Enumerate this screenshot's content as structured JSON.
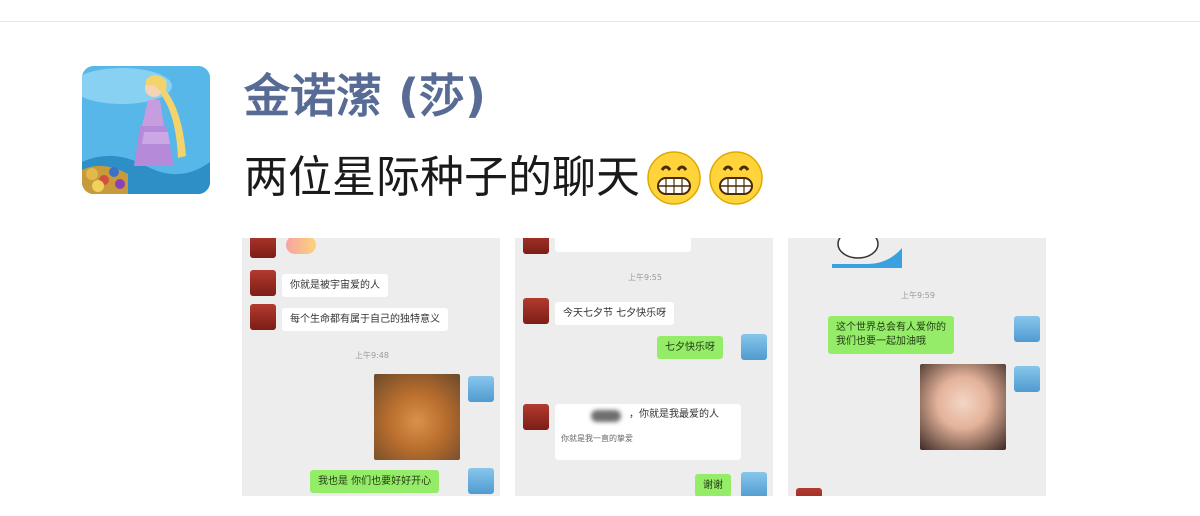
{
  "post": {
    "user_name": "金诺潆 (莎)",
    "text": "两位星际种子的聊天",
    "emojis": [
      "grinning-face-emoji",
      "grinning-face-emoji"
    ]
  },
  "thumbnails": [
    {
      "messages": [
        "你就是被宇宙爱的人",
        "每个生命都有属于自己的独特意义",
        "我也是 你们也要好好开心"
      ],
      "timestamp": "上午9:48"
    },
    {
      "messages": [
        "今天七夕节 七夕快乐呀",
        "七夕快乐呀",
        "，你就是我最爱的人",
        "你就是我一直的挚爱",
        "谢谢"
      ],
      "timestamp": "上午9:55"
    },
    {
      "messages": [
        "这个世界总会有人爱你的",
        "我们也要一起加油哦"
      ],
      "timestamp": "上午9:59"
    }
  ]
}
